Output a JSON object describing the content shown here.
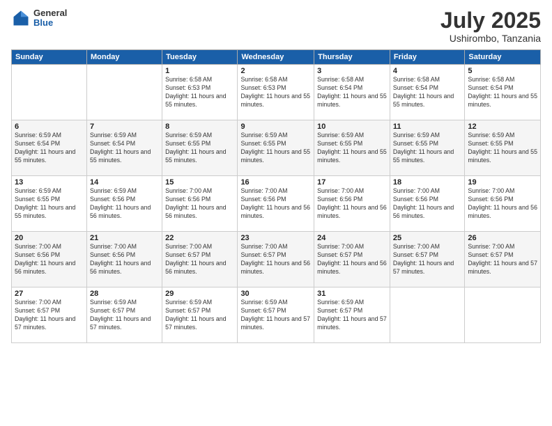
{
  "logo": {
    "general": "General",
    "blue": "Blue"
  },
  "title": "July 2025",
  "location": "Ushirombo, Tanzania",
  "weekdays": [
    "Sunday",
    "Monday",
    "Tuesday",
    "Wednesday",
    "Thursday",
    "Friday",
    "Saturday"
  ],
  "weeks": [
    [
      {
        "day": "",
        "info": ""
      },
      {
        "day": "",
        "info": ""
      },
      {
        "day": "1",
        "info": "Sunrise: 6:58 AM\nSunset: 6:53 PM\nDaylight: 11 hours and 55 minutes."
      },
      {
        "day": "2",
        "info": "Sunrise: 6:58 AM\nSunset: 6:53 PM\nDaylight: 11 hours and 55 minutes."
      },
      {
        "day": "3",
        "info": "Sunrise: 6:58 AM\nSunset: 6:54 PM\nDaylight: 11 hours and 55 minutes."
      },
      {
        "day": "4",
        "info": "Sunrise: 6:58 AM\nSunset: 6:54 PM\nDaylight: 11 hours and 55 minutes."
      },
      {
        "day": "5",
        "info": "Sunrise: 6:58 AM\nSunset: 6:54 PM\nDaylight: 11 hours and 55 minutes."
      }
    ],
    [
      {
        "day": "6",
        "info": "Sunrise: 6:59 AM\nSunset: 6:54 PM\nDaylight: 11 hours and 55 minutes."
      },
      {
        "day": "7",
        "info": "Sunrise: 6:59 AM\nSunset: 6:54 PM\nDaylight: 11 hours and 55 minutes."
      },
      {
        "day": "8",
        "info": "Sunrise: 6:59 AM\nSunset: 6:55 PM\nDaylight: 11 hours and 55 minutes."
      },
      {
        "day": "9",
        "info": "Sunrise: 6:59 AM\nSunset: 6:55 PM\nDaylight: 11 hours and 55 minutes."
      },
      {
        "day": "10",
        "info": "Sunrise: 6:59 AM\nSunset: 6:55 PM\nDaylight: 11 hours and 55 minutes."
      },
      {
        "day": "11",
        "info": "Sunrise: 6:59 AM\nSunset: 6:55 PM\nDaylight: 11 hours and 55 minutes."
      },
      {
        "day": "12",
        "info": "Sunrise: 6:59 AM\nSunset: 6:55 PM\nDaylight: 11 hours and 55 minutes."
      }
    ],
    [
      {
        "day": "13",
        "info": "Sunrise: 6:59 AM\nSunset: 6:55 PM\nDaylight: 11 hours and 55 minutes."
      },
      {
        "day": "14",
        "info": "Sunrise: 6:59 AM\nSunset: 6:56 PM\nDaylight: 11 hours and 56 minutes."
      },
      {
        "day": "15",
        "info": "Sunrise: 7:00 AM\nSunset: 6:56 PM\nDaylight: 11 hours and 56 minutes."
      },
      {
        "day": "16",
        "info": "Sunrise: 7:00 AM\nSunset: 6:56 PM\nDaylight: 11 hours and 56 minutes."
      },
      {
        "day": "17",
        "info": "Sunrise: 7:00 AM\nSunset: 6:56 PM\nDaylight: 11 hours and 56 minutes."
      },
      {
        "day": "18",
        "info": "Sunrise: 7:00 AM\nSunset: 6:56 PM\nDaylight: 11 hours and 56 minutes."
      },
      {
        "day": "19",
        "info": "Sunrise: 7:00 AM\nSunset: 6:56 PM\nDaylight: 11 hours and 56 minutes."
      }
    ],
    [
      {
        "day": "20",
        "info": "Sunrise: 7:00 AM\nSunset: 6:56 PM\nDaylight: 11 hours and 56 minutes."
      },
      {
        "day": "21",
        "info": "Sunrise: 7:00 AM\nSunset: 6:56 PM\nDaylight: 11 hours and 56 minutes."
      },
      {
        "day": "22",
        "info": "Sunrise: 7:00 AM\nSunset: 6:57 PM\nDaylight: 11 hours and 56 minutes."
      },
      {
        "day": "23",
        "info": "Sunrise: 7:00 AM\nSunset: 6:57 PM\nDaylight: 11 hours and 56 minutes."
      },
      {
        "day": "24",
        "info": "Sunrise: 7:00 AM\nSunset: 6:57 PM\nDaylight: 11 hours and 56 minutes."
      },
      {
        "day": "25",
        "info": "Sunrise: 7:00 AM\nSunset: 6:57 PM\nDaylight: 11 hours and 57 minutes."
      },
      {
        "day": "26",
        "info": "Sunrise: 7:00 AM\nSunset: 6:57 PM\nDaylight: 11 hours and 57 minutes."
      }
    ],
    [
      {
        "day": "27",
        "info": "Sunrise: 7:00 AM\nSunset: 6:57 PM\nDaylight: 11 hours and 57 minutes."
      },
      {
        "day": "28",
        "info": "Sunrise: 6:59 AM\nSunset: 6:57 PM\nDaylight: 11 hours and 57 minutes."
      },
      {
        "day": "29",
        "info": "Sunrise: 6:59 AM\nSunset: 6:57 PM\nDaylight: 11 hours and 57 minutes."
      },
      {
        "day": "30",
        "info": "Sunrise: 6:59 AM\nSunset: 6:57 PM\nDaylight: 11 hours and 57 minutes."
      },
      {
        "day": "31",
        "info": "Sunrise: 6:59 AM\nSunset: 6:57 PM\nDaylight: 11 hours and 57 minutes."
      },
      {
        "day": "",
        "info": ""
      },
      {
        "day": "",
        "info": ""
      }
    ]
  ]
}
